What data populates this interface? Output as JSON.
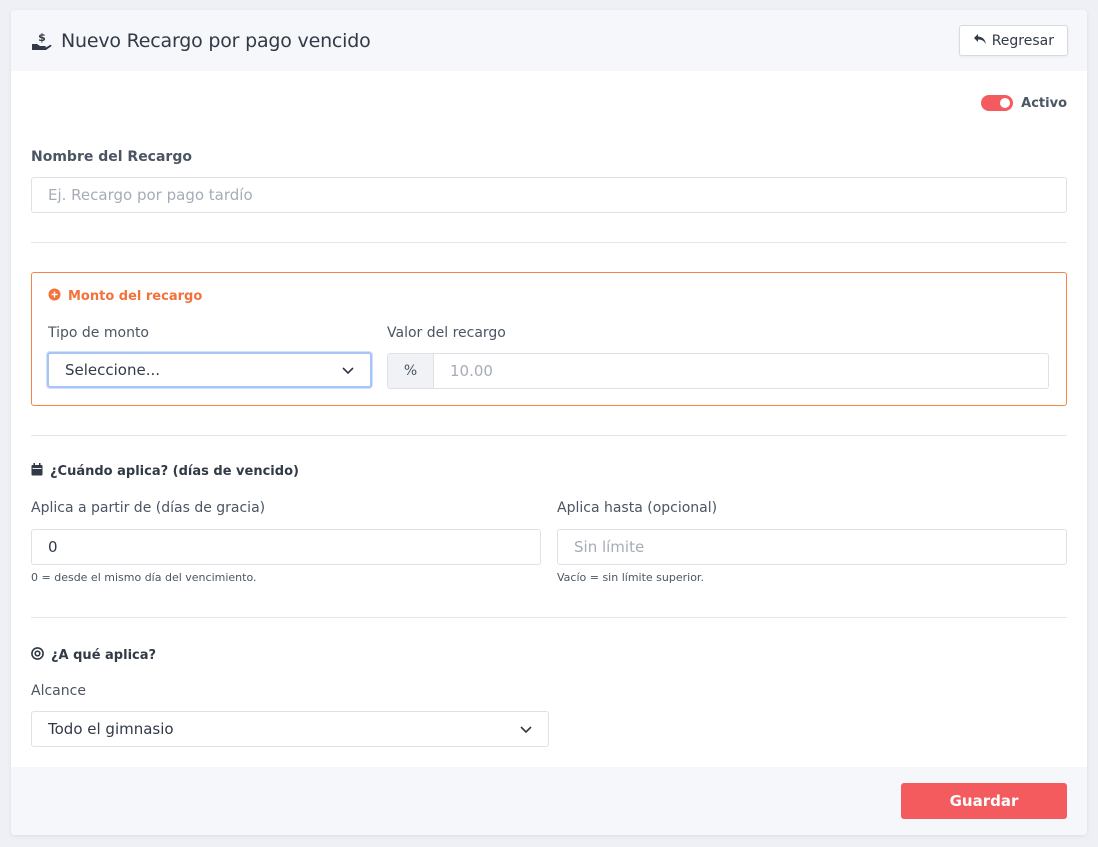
{
  "header": {
    "title": "Nuevo Recargo por pago vencido",
    "back_label": "Regresar"
  },
  "status": {
    "toggle_label": "Activo",
    "active": true
  },
  "nombre": {
    "label": "Nombre del Recargo",
    "placeholder": "Ej. Recargo por pago tardío"
  },
  "monto": {
    "title": "Monto del recargo",
    "tipo_label": "Tipo de monto",
    "tipo_value": "Seleccione...",
    "valor_label": "Valor del recargo",
    "valor_addon": "%",
    "valor_placeholder": "10.00"
  },
  "cuando": {
    "title": "¿Cuándo aplica? (días de vencido)",
    "desde_label": "Aplica a partir de (días de gracia)",
    "desde_value": "0",
    "desde_help": "0 = desde el mismo día del vencimiento.",
    "hasta_label": "Aplica hasta (opcional)",
    "hasta_placeholder": "Sin límite",
    "hasta_help": "Vacío = sin límite superior."
  },
  "aplica": {
    "title": "¿A qué aplica?",
    "alcance_label": "Alcance",
    "alcance_value": "Todo el gimnasio"
  },
  "footer": {
    "save_label": "Guardar"
  },
  "colors": {
    "accent": "#f35b5e",
    "orange": "#f2723c",
    "focus": "#a8c4f5"
  }
}
